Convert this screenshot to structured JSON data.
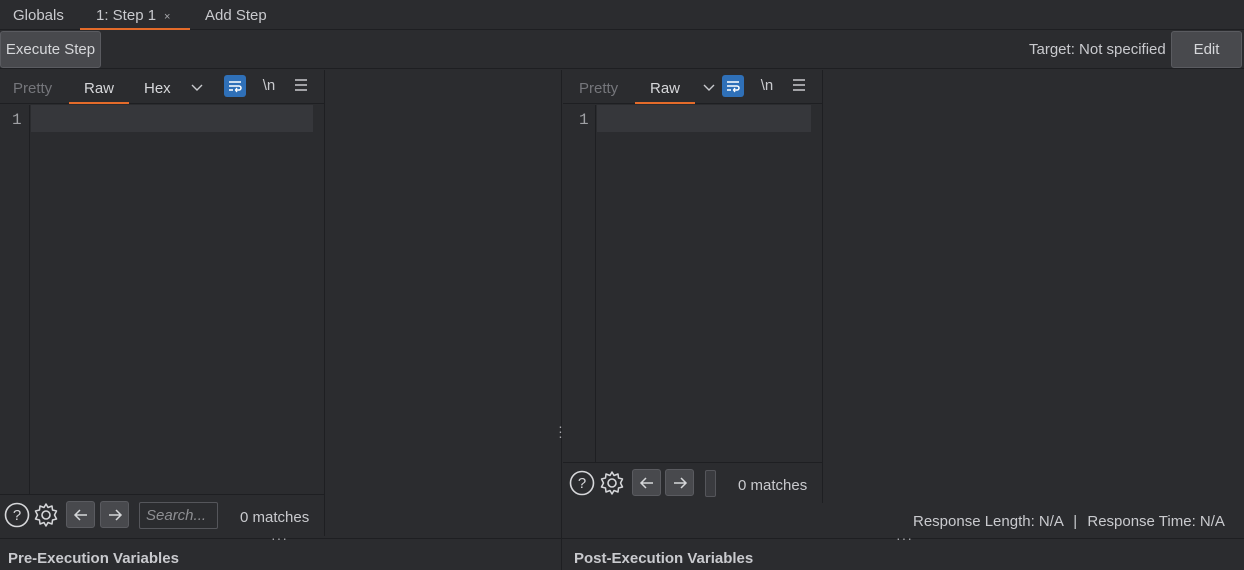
{
  "tabs": {
    "globals": "Globals",
    "step": "1: Step 1",
    "close": "×",
    "add": "Add Step"
  },
  "toolbar": {
    "execute": "Execute Step",
    "target": "Target: Not specified",
    "edit": "Edit"
  },
  "request_pane": {
    "tabs": [
      "Pretty",
      "Raw",
      "Hex"
    ],
    "active_tab": "Raw",
    "line_number": "1",
    "newline_label": "\\n",
    "search_placeholder": "Search...",
    "matches": "0 matches"
  },
  "response_pane": {
    "tabs": [
      "Pretty",
      "Raw"
    ],
    "active_tab": "Raw",
    "line_number": "1",
    "newline_label": "\\n",
    "matches": "0 matches"
  },
  "status": {
    "response_length": "Response Length:  N/A",
    "separator": "|",
    "response_time": "Response Time:  N/A"
  },
  "footer": {
    "pre": "Pre-Execution Variables",
    "post": "Post-Execution Variables"
  },
  "colors": {
    "accent": "#e46b2a",
    "wrap_active": "#2f70b8",
    "background": "#2b2c2f"
  },
  "icons": [
    "help-icon",
    "gear-icon",
    "arrow-left-icon",
    "arrow-right-icon",
    "wrap-icon",
    "menu-icon",
    "chevron-down-icon"
  ]
}
